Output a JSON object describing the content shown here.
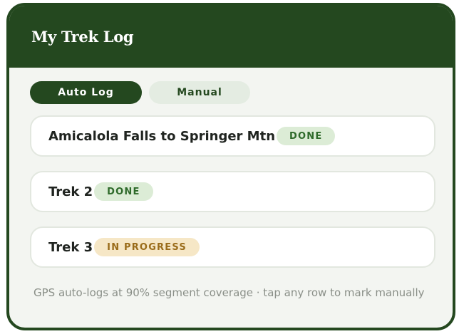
{
  "header": {
    "title": "My Trek Log"
  },
  "tabs": [
    {
      "label": "Auto Log",
      "active": true
    },
    {
      "label": "Manual",
      "active": false
    }
  ],
  "treks": [
    {
      "name": "Amicalola Falls to Springer Mtn",
      "status": "DONE"
    },
    {
      "name": "Trek 2",
      "status": "DONE"
    },
    {
      "name": "Trek 3",
      "status": "IN PROGRESS"
    }
  ],
  "footer": {
    "note": "GPS auto-logs at 90% segment coverage · tap any row to mark manually"
  },
  "colors": {
    "brand_green": "#24481f",
    "done_badge_bg": "#dcecd6",
    "done_badge_text": "#2e6a2a",
    "progress_badge_bg": "#f6e7c6",
    "progress_badge_text": "#9a6c1a"
  }
}
